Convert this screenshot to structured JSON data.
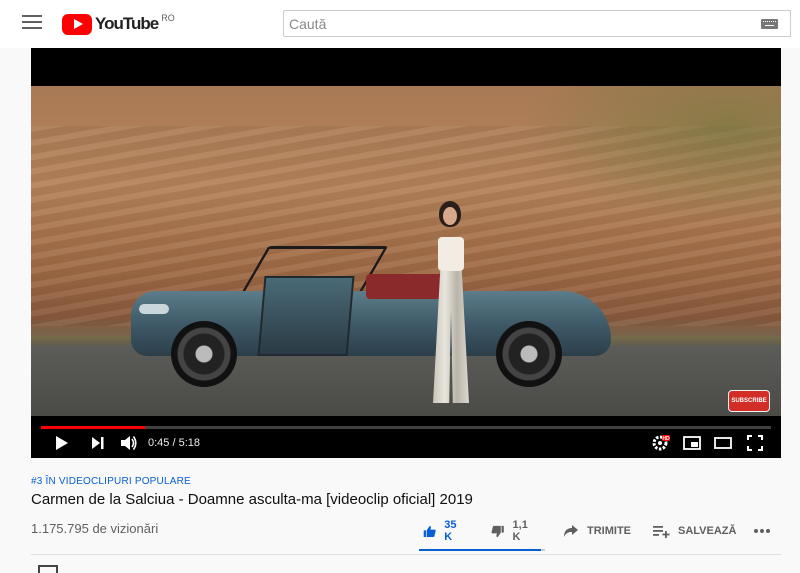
{
  "masthead": {
    "logo_text": "YouTube",
    "country_code": "RO",
    "search_placeholder": "Caută",
    "icons": {
      "menu": "hamburger-menu-icon",
      "keyboard": "keyboard-icon"
    }
  },
  "player": {
    "time_current": "0:45",
    "time_separator": " / ",
    "time_total": "5:18",
    "progress_fraction": 0.142,
    "subscribe_badge": "SUBSCRIBE",
    "icons": {
      "play": "play-icon",
      "next": "skip-next-icon",
      "volume": "volume-icon",
      "settings": "settings-hd-icon",
      "miniplayer": "miniplayer-icon",
      "theater": "theater-mode-icon",
      "fullscreen": "fullscreen-icon"
    },
    "accent_color": "#ff0000"
  },
  "video": {
    "hashtag": "#3 ÎN VIDEOCLIPURI POPULARE",
    "title": "Carmen de la Salciua - Doamne asculta-ma [videoclip oficial] 2019",
    "views": "1.175.795 de vizionări",
    "like_fraction": 0.97
  },
  "actions": {
    "like_count": "35 K",
    "dislike_count": "1,1 K",
    "share_label": "TRIMITE",
    "save_label": "SALVEAZĂ",
    "icons": {
      "like": "thumbs-up-icon",
      "dislike": "thumbs-down-icon",
      "share": "share-arrow-icon",
      "save": "playlist-add-icon",
      "more": "more-options-icon"
    },
    "active_color": "#065fd4"
  }
}
